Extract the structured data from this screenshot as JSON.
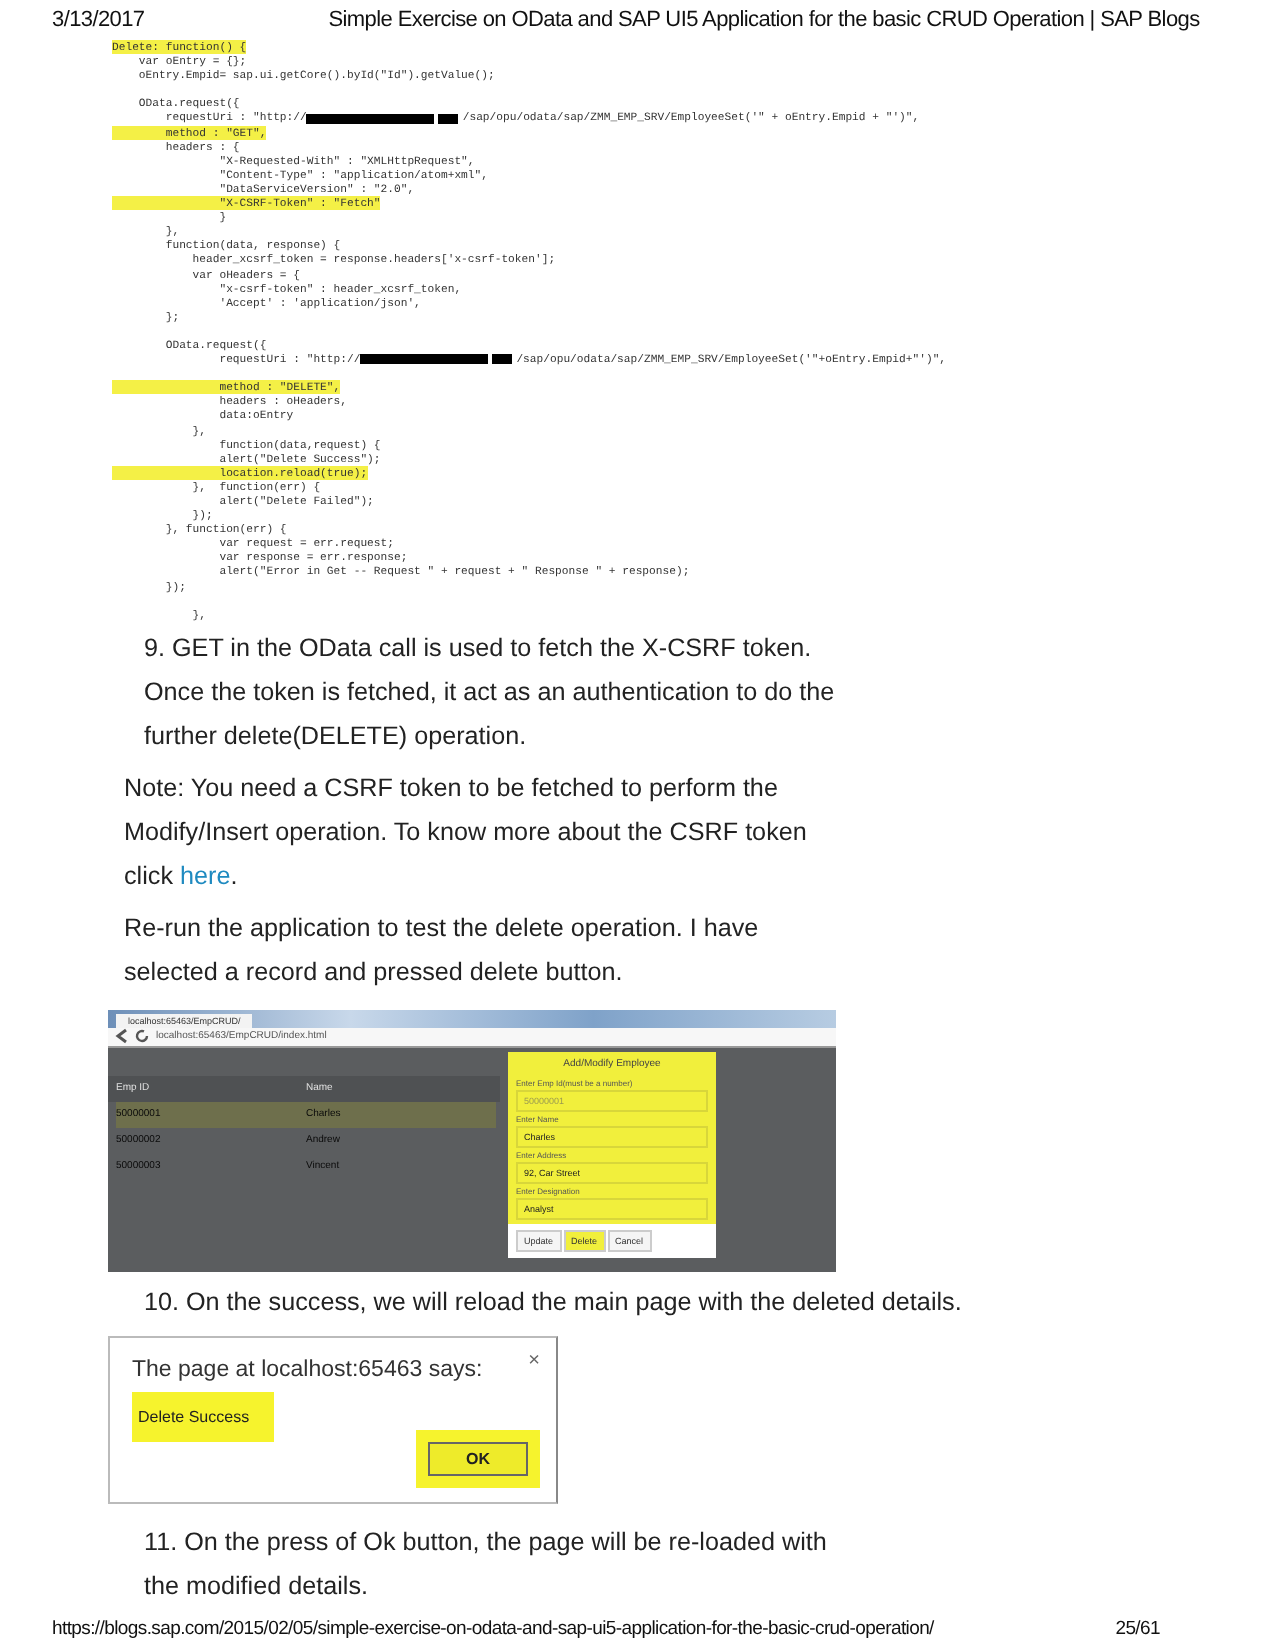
{
  "print_header": {
    "date": "3/13/2017",
    "title": "Simple Exercise on OData and SAP UI5 Application for the basic CRUD Operation | SAP Blogs"
  },
  "code_image": {
    "lines": [
      {
        "highlighted": true,
        "segments": [
          {
            "kind": "code",
            "text": "Delete: function() {"
          }
        ]
      },
      {
        "highlighted": false,
        "segments": [
          {
            "kind": "code",
            "text": "    var oEntry = {};"
          }
        ]
      },
      {
        "highlighted": false,
        "segments": [
          {
            "kind": "code",
            "text": "    oEntry.Empid= sap.ui.getCore().byId(\"Id\").getValue();"
          }
        ]
      },
      {
        "kind": "blank"
      },
      {
        "highlighted": false,
        "segments": [
          {
            "kind": "code",
            "text": "    OData.request({"
          }
        ]
      },
      {
        "highlighted": false,
        "segments": [
          {
            "kind": "code",
            "text": "        requestUri : \"http://"
          },
          {
            "kind": "redacted"
          },
          {
            "kind": "redacted_short"
          },
          {
            "kind": "code",
            "text": "/sap/opu/odata/sap/ZMM_EMP_SRV/EmployeeSet('\" + oEntry.Empid + \"')\","
          }
        ]
      },
      {
        "highlighted": true,
        "segments": [
          {
            "kind": "code",
            "text": "        method : \"GET\","
          }
        ]
      },
      {
        "highlighted": false,
        "segments": [
          {
            "kind": "code",
            "text": "        headers : {"
          }
        ]
      },
      {
        "highlighted": false,
        "segments": [
          {
            "kind": "code",
            "text": "                \"X-Requested-With\" : \"XMLHttpRequest\","
          }
        ]
      },
      {
        "highlighted": false,
        "segments": [
          {
            "kind": "code",
            "text": "                \"Content-Type\" : \"application/atom+xml\","
          }
        ]
      },
      {
        "highlighted": false,
        "segments": [
          {
            "kind": "code",
            "text": "                \"DataServiceVersion\" : \"2.0\","
          }
        ]
      },
      {
        "highlighted": true,
        "segments": [
          {
            "kind": "code",
            "text": "                \"X-CSRF-Token\" : \"Fetch\""
          }
        ]
      },
      {
        "highlighted": false,
        "segments": [
          {
            "kind": "code",
            "text": "                }"
          }
        ]
      },
      {
        "highlighted": false,
        "segments": [
          {
            "kind": "code",
            "text": "        },"
          }
        ]
      },
      {
        "highlighted": false,
        "segments": [
          {
            "kind": "code",
            "text": "        function(data, response) {"
          }
        ]
      },
      {
        "highlighted": false,
        "segments": [
          {
            "kind": "code",
            "text": "            header_xcsrf_token = response.headers['x-csrf-token'];"
          }
        ]
      },
      {
        "highlighted": false,
        "segments": [
          {
            "kind": "code",
            "text": "            var oHeaders = {"
          }
        ]
      },
      {
        "highlighted": false,
        "segments": [
          {
            "kind": "code",
            "text": "                \"x-csrf-token\" : header_xcsrf_token,"
          }
        ]
      },
      {
        "highlighted": false,
        "segments": [
          {
            "kind": "code",
            "text": "                'Accept' : 'application/json',"
          }
        ]
      },
      {
        "highlighted": false,
        "segments": [
          {
            "kind": "code",
            "text": "        };"
          }
        ]
      },
      {
        "kind": "blank"
      },
      {
        "highlighted": false,
        "segments": [
          {
            "kind": "code",
            "text": "        OData.request({"
          }
        ]
      },
      {
        "highlighted": false,
        "segments": [
          {
            "kind": "code",
            "text": "                requestUri : \"http://"
          },
          {
            "kind": "redacted"
          },
          {
            "kind": "redacted_short"
          },
          {
            "kind": "code",
            "text": "/sap/opu/odata/sap/ZMM_EMP_SRV/EmployeeSet('\"+oEntry.Empid+\"')\","
          }
        ]
      },
      {
        "kind": "blank"
      },
      {
        "highlighted": true,
        "segments": [
          {
            "kind": "code",
            "text": "                method : \"DELETE\","
          }
        ]
      },
      {
        "highlighted": false,
        "segments": [
          {
            "kind": "code",
            "text": "                headers : oHeaders,"
          }
        ]
      },
      {
        "highlighted": false,
        "segments": [
          {
            "kind": "code",
            "text": "                data:oEntry"
          }
        ]
      },
      {
        "highlighted": false,
        "segments": [
          {
            "kind": "code",
            "text": "            },"
          }
        ]
      },
      {
        "highlighted": false,
        "segments": [
          {
            "kind": "code",
            "text": "                function(data,request) {"
          }
        ]
      },
      {
        "highlighted": false,
        "segments": [
          {
            "kind": "code",
            "text": "                alert(\"Delete Success\");"
          }
        ]
      },
      {
        "highlighted": true,
        "segments": [
          {
            "kind": "code",
            "text": "                location.reload(true);"
          }
        ]
      },
      {
        "highlighted": false,
        "segments": [
          {
            "kind": "code",
            "text": "            },  function(err) {"
          }
        ]
      },
      {
        "highlighted": false,
        "segments": [
          {
            "kind": "code",
            "text": "                alert(\"Delete Failed\");"
          }
        ]
      },
      {
        "highlighted": false,
        "segments": [
          {
            "kind": "code",
            "text": "            });"
          }
        ]
      },
      {
        "highlighted": false,
        "segments": [
          {
            "kind": "code",
            "text": "        }, function(err) {"
          }
        ]
      },
      {
        "highlighted": false,
        "segments": [
          {
            "kind": "code",
            "text": "                var request = err.request;"
          }
        ]
      },
      {
        "highlighted": false,
        "segments": [
          {
            "kind": "code",
            "text": "                var response = err.response;"
          }
        ]
      },
      {
        "highlighted": false,
        "segments": [
          {
            "kind": "code",
            "text": "                alert(\"Error in Get -- Request \" + request + \" Response \" + response);"
          }
        ]
      },
      {
        "highlighted": false,
        "segments": [
          {
            "kind": "code",
            "text": "        });"
          }
        ]
      },
      {
        "kind": "blank"
      },
      {
        "highlighted": false,
        "segments": [
          {
            "kind": "code",
            "text": "            },"
          }
        ]
      }
    ]
  },
  "paragraphs_top": [
    {
      "kind": "numbered",
      "number": "9.",
      "text": "GET in the OData call is used to fetch the X-CSRF token. Once the token is fetched, it act as an authentication to do the further delete(DELETE) operation."
    },
    {
      "kind": "note",
      "text": "Note: You need a CSRF token to be fetched to perform the Modify/Insert operation. To know more about the CSRF token click ",
      "link": "here",
      "after": "."
    },
    {
      "kind": "plain",
      "text": "Re-run the application to test the delete operation. I have selected a record and pressed delete button."
    }
  ],
  "app_screenshot": {
    "tab_title": "localhost:65463/EmpCRUD/",
    "address": "localhost:65463/EmpCRUD/index.html",
    "columns": [
      "Emp ID",
      "Name"
    ],
    "rows": [
      {
        "cells": [
          "50000001",
          "Charles"
        ],
        "selected": true
      },
      {
        "cells": [
          "50000002",
          "Andrew"
        ],
        "selected": false
      },
      {
        "cells": [
          "50000003",
          "Vincent"
        ],
        "selected": false
      }
    ],
    "dialog": {
      "title": "Add/Modify Employee",
      "fields": [
        {
          "label": "Enter Emp Id(must be a number)",
          "value": "50000001",
          "disabled": true
        },
        {
          "label": "Enter Name",
          "value": "Charles",
          "disabled": false
        },
        {
          "label": "Enter Address",
          "value": "92, Car Street",
          "disabled": false
        },
        {
          "label": "Enter Designation",
          "value": "Analyst",
          "disabled": false
        }
      ],
      "buttons": [
        {
          "label": "Update",
          "highlighted": false
        },
        {
          "label": "Delete",
          "highlighted": true
        },
        {
          "label": "Cancel",
          "highlighted": false
        }
      ]
    }
  },
  "paragraph_middle": {
    "kind": "numbered",
    "number": "10.",
    "text": "On the success, we will reload the main page with the deleted details."
  },
  "alert_screenshot": {
    "title": "The page at localhost:65463 says:",
    "close": "×",
    "message": "Delete Success",
    "button": "OK"
  },
  "paragraph_bottom": {
    "kind": "numbered",
    "number": "11.",
    "text": "On the press of Ok button, the page will be re-loaded with the modified details."
  },
  "print_footer": {
    "url": "https://blogs.sap.com/2015/02/05/simple-exercise-on-odata-and-sap-ui5-application-for-the-basic-crud-operation/",
    "page": "25/61"
  }
}
